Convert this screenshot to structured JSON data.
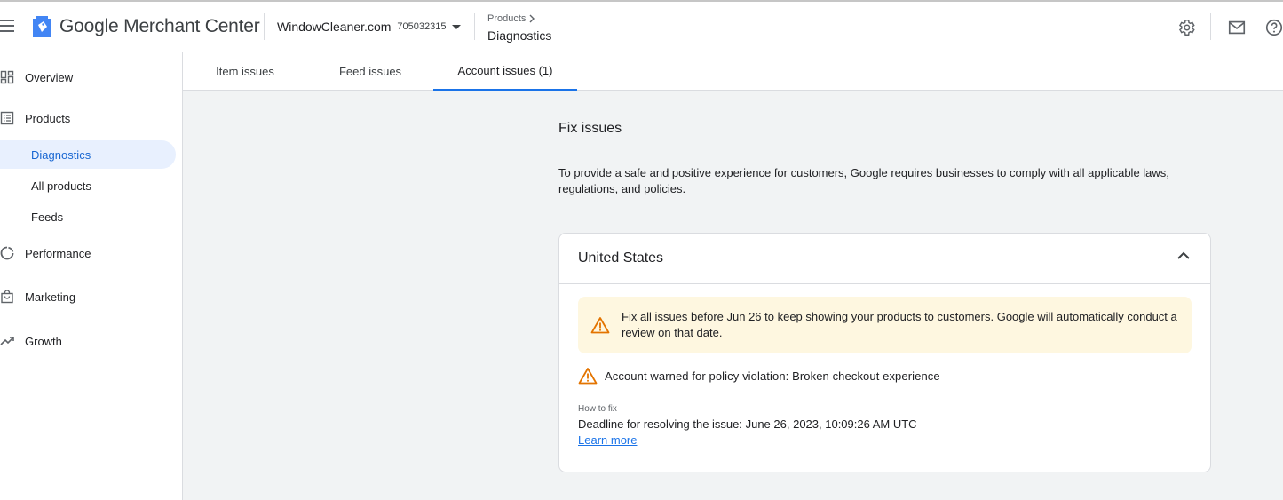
{
  "header": {
    "brand": "Google Merchant Center",
    "account_name": "WindowCleaner.com",
    "account_id": "705032315",
    "breadcrumb_parent": "Products",
    "breadcrumb_current": "Diagnostics",
    "icons": [
      "menu-icon",
      "merchant-center-logo",
      "settings-icon",
      "mail-icon",
      "help-icon"
    ]
  },
  "sidebar": {
    "overview": "Overview",
    "products": "Products",
    "sub_items": [
      {
        "label": "Diagnostics",
        "active": true
      },
      {
        "label": "All products",
        "active": false
      },
      {
        "label": "Feeds",
        "active": false
      }
    ],
    "performance": "Performance",
    "marketing": "Marketing",
    "growth": "Growth"
  },
  "tabs": [
    {
      "label": "Item issues",
      "active": false
    },
    {
      "label": "Feed issues",
      "active": false
    },
    {
      "label": "Account issues (1)",
      "active": true
    }
  ],
  "content": {
    "title": "Fix issues",
    "description": "To provide a safe and positive experience for customers, Google requires businesses to comply with all applicable laws, regulations, and policies.",
    "card": {
      "region": "United States",
      "banner": "Fix all issues before Jun 26 to keep showing your products to customers. Google will automatically conduct a review on that date.",
      "issue": "Account warned for policy violation: Broken checkout experience",
      "how_to_fix_label": "How to fix",
      "deadline": "Deadline for resolving the issue: June 26, 2023, 10:09:26 AM UTC",
      "learn_more": "Learn more"
    }
  },
  "colors": {
    "accent": "#1a73e8",
    "active_nav_bg": "#e8f0fe",
    "warning": "#e37400",
    "banner_bg": "#fef7e0",
    "main_bg": "#f1f3f4"
  }
}
